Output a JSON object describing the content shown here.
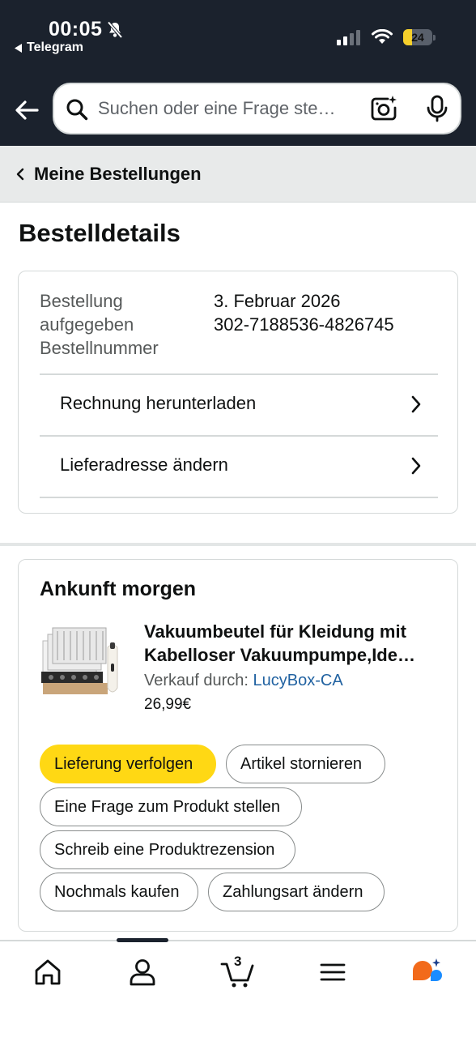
{
  "status_bar": {
    "time": "00:05",
    "back_app": "Telegram",
    "battery": "24"
  },
  "search": {
    "placeholder": "Suchen oder eine Frage ste…"
  },
  "breadcrumb": {
    "label": "Meine Bestellungen"
  },
  "page": {
    "title": "Bestelldetails"
  },
  "order": {
    "placed_label": "Bestellung aufgegeben",
    "placed_value": "3. Februar 2026",
    "number_label": "Bestellnummer",
    "number_value": "302-7188536-4826745",
    "links": [
      {
        "label": "Rechnung herunterladen"
      },
      {
        "label": "Lieferadresse ändern"
      }
    ]
  },
  "arrival": {
    "title": "Ankunft morgen",
    "product": {
      "title_line1": "Vakuumbeutel für Kleidung mit",
      "title_line2": "Kabelloser Vakuumpumpe,Ide…",
      "seller_prefix": "Verkauf durch: ",
      "seller_name": "LucyBox-CA",
      "price": "26,99€"
    },
    "buttons": [
      {
        "label": "Lieferung verfolgen",
        "primary": true
      },
      {
        "label": "Artikel stornieren"
      },
      {
        "label": "Eine Frage zum Produkt stellen"
      },
      {
        "label": "Schreib eine Produktrezension"
      },
      {
        "label": "Nochmals kaufen"
      },
      {
        "label": "Zahlungsart ändern"
      }
    ]
  },
  "bottom_nav": {
    "items": [
      {
        "icon": "home-icon"
      },
      {
        "icon": "account-icon"
      },
      {
        "icon": "cart-icon"
      },
      {
        "icon": "menu-icon"
      },
      {
        "icon": "rufus-assistant-icon"
      }
    ],
    "cart_count": "3"
  },
  "colors": {
    "header_bg": "#1b222d",
    "primary_button": "#ffd814",
    "link": "#2162a1"
  }
}
